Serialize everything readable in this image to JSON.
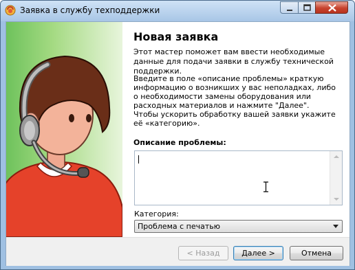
{
  "window": {
    "title": "Заявка в службу техподдержки"
  },
  "wizard": {
    "heading": "Новая заявка",
    "intro": "Этот мастер поможет вам ввести необходимые данные для подачи заявки в службу технической поддержки.",
    "description": "Введите в поле «описание проблемы» краткую информацию о возникших у вас неполадках, либо о необходимости замены оборудования или расходных материалов и нажмите \"Далее\".\nЧтобы ускорить обработку вашей заявки укажите её «категорию».",
    "problem_label": "Описание проблемы:",
    "problem_value": "",
    "category_label": "Категория:",
    "category_value": "Проблема с печатью"
  },
  "buttons": {
    "back": "< Назад",
    "next": "Далее >",
    "cancel": "Отмена"
  },
  "icons": {
    "app": "support-app-icon",
    "illustration": "support-operator-headset"
  },
  "colors": {
    "sidebar_start": "#6ec25c",
    "sidebar_end": "#e8f5dc",
    "close_button": "#c7432e",
    "default_button_border": "#3c7fb1"
  }
}
